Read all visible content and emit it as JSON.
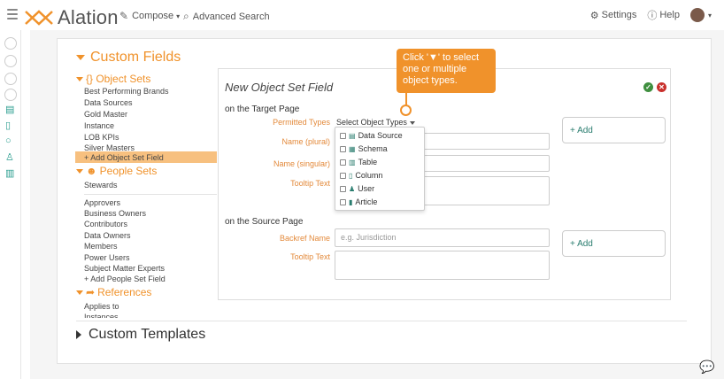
{
  "topbar": {
    "brand": "Alation",
    "compose_label": "Compose",
    "advanced_search_label": "Advanced Search",
    "settings_label": "Settings",
    "help_label": "Help"
  },
  "sidebar_nav": {
    "section_title": "Custom Fields",
    "object_sets_title": "{} Object Sets",
    "object_sets_items": [
      "Best Performing Brands",
      "Data Sources",
      "Gold Master",
      "Instance",
      "LOB KPIs",
      "Silver Masters"
    ],
    "add_object_set": "+ Add Object Set Field",
    "people_sets_title": "People Sets",
    "people_sets_items": [
      "Stewards",
      "Approvers",
      "Business Owners",
      "Contributors",
      "Data Owners",
      "Members",
      "Power Users",
      "Subject Matter Experts"
    ],
    "add_people_set": "+ Add People Set Field",
    "references_title": "References",
    "references_items": [
      "Applies to",
      "Instances"
    ]
  },
  "form": {
    "title": "New Object Set Field",
    "target_page_label": "on the Target Page",
    "permitted_types_label": "Permitted Types",
    "select_types_label": "Select Object Types",
    "name_plural_label": "Name (plural)",
    "name_singular_label": "Name (singular)",
    "tooltip_label": "Tooltip Text",
    "add_label": "+ Add",
    "source_page_label": "on the Source Page",
    "backref_label": "Backref Name",
    "backref_placeholder": "e.g. Jurisdiction",
    "source_tooltip_label": "Tooltip Text",
    "source_add_label": "+ Add"
  },
  "dropdown": {
    "options": [
      {
        "label": "Data Source",
        "icon": "database-icon"
      },
      {
        "label": "Schema",
        "icon": "schema-icon"
      },
      {
        "label": "Table",
        "icon": "table-icon"
      },
      {
        "label": "Column",
        "icon": "column-icon"
      },
      {
        "label": "User",
        "icon": "user-icon"
      },
      {
        "label": "Article",
        "icon": "article-icon"
      }
    ]
  },
  "callout": {
    "text": "Click '▼' to select one or multiple object types."
  },
  "templates_title": "Custom Templates",
  "colors": {
    "accent": "#f0922b",
    "teal": "#2a7d6f",
    "selected_row": "#f7c07f"
  }
}
